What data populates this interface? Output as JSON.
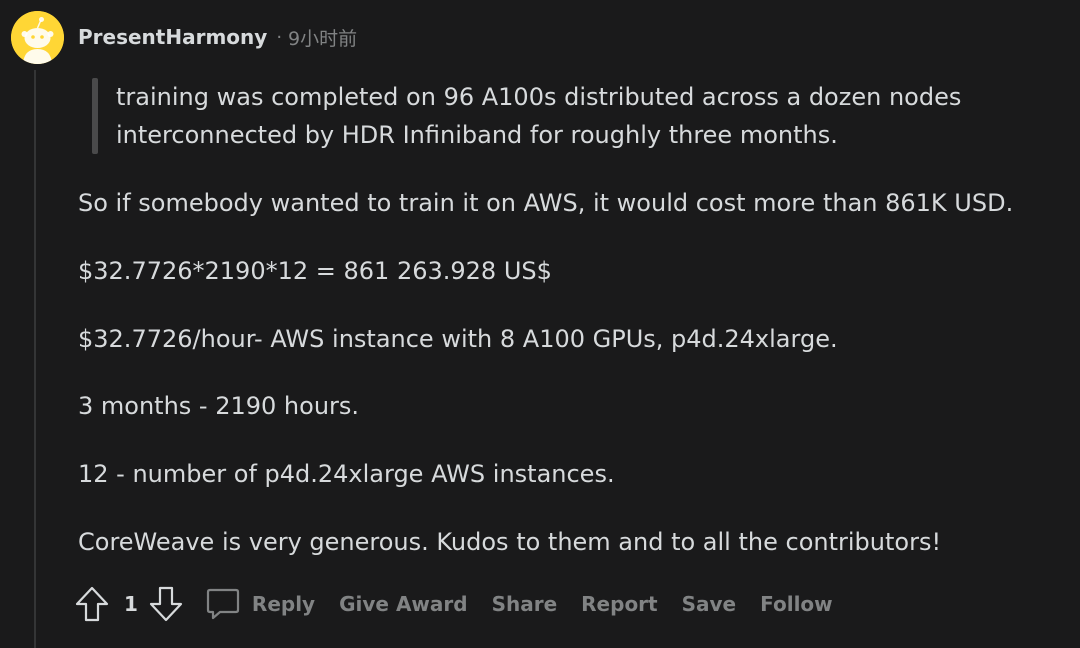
{
  "comment": {
    "author": "PresentHarmony",
    "separator": "·",
    "time": "9小时前",
    "quote": [
      "training was completed on 96 A100s distributed across a dozen nodes",
      "interconnected by HDR Infiniband for roughly three months."
    ],
    "paragraphs": [
      "So if somebody wanted to train it on AWS, it would cost more than 861K USD.",
      "$32.7726*2190*12 = 861 263.928 US$",
      "$32.7726/hour- AWS instance with 8 A100 GPUs, p4d.24xlarge.",
      "3 months - 2190 hours.",
      "12 - number of p4d.24xlarge AWS instances.",
      "CoreWeave is very generous. Kudos to them and to all the contributors!"
    ]
  },
  "actions": {
    "vote_count": "1",
    "reply": "Reply",
    "give_award": "Give Award",
    "share": "Share",
    "report": "Report",
    "save": "Save",
    "follow": "Follow"
  },
  "icons": {
    "avatar": "snoo-avatar-icon",
    "upvote": "upvote-arrow-icon",
    "downvote": "downvote-arrow-icon",
    "reply": "speech-bubble-icon"
  },
  "colors": {
    "background": "#1a1a1b",
    "text": "#d7dadc",
    "muted": "#818384",
    "avatar": "#ffd635"
  }
}
